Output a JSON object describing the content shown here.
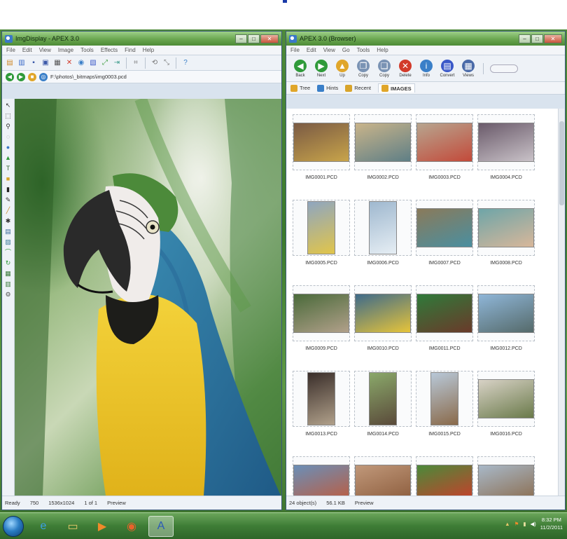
{
  "left_window": {
    "title": "ImgDisplay - APEX 3.0",
    "menu": [
      "File",
      "Edit",
      "View",
      "Image",
      "Tools",
      "Effects",
      "Find",
      "Help"
    ],
    "path": "F:\\photos\\_bitmaps\\img0003.pcd",
    "status": {
      "state": "Ready",
      "size": "750",
      "dims": "1536x1024",
      "ratio": "1 of 1",
      "label": "Preview"
    }
  },
  "right_window": {
    "title": "APEX 3.0 (Browser)",
    "menu": [
      "File",
      "Edit",
      "View",
      "Go",
      "Tools",
      "Help"
    ],
    "toolbar": [
      {
        "label": "Back",
        "icon": "back-icon",
        "color": "#2f9a3a"
      },
      {
        "label": "Next",
        "icon": "forward-icon",
        "color": "#2f9a3a"
      },
      {
        "label": "Up",
        "icon": "up-folder-icon",
        "color": "#e0a62a"
      },
      {
        "label": "Copy",
        "icon": "copy-icon",
        "color": "#7a93b4"
      },
      {
        "label": "Copy",
        "icon": "copy-to-icon",
        "color": "#7a93b4"
      },
      {
        "label": "Delete",
        "icon": "delete-icon",
        "color": "#d23a2a"
      },
      {
        "label": "Info",
        "icon": "info-icon",
        "color": "#3a7fc8"
      },
      {
        "label": "Convert",
        "icon": "convert-icon",
        "color": "#3a58c8"
      },
      {
        "label": "Views",
        "icon": "views-icon",
        "color": "#4a6aa8"
      }
    ],
    "tabs": [
      {
        "label": "Tree",
        "icon": "tree-icon"
      },
      {
        "label": "Hints",
        "icon": "hints-icon"
      },
      {
        "label": "Recent",
        "icon": "recent-icon"
      },
      {
        "label": "IMAGES",
        "icon": "folder-icon",
        "active": true
      }
    ],
    "thumbnails": [
      {
        "caption": "IMG0001.PCD",
        "orient": "landscape",
        "c1": "#7a5a44",
        "c2": "#c8a44a"
      },
      {
        "caption": "IMG0002.PCD",
        "orient": "landscape",
        "c1": "#c9b48a",
        "c2": "#5f7f86"
      },
      {
        "caption": "IMG0003.PCD",
        "orient": "landscape",
        "c1": "#b7a58f",
        "c2": "#c34a3a"
      },
      {
        "caption": "IMG0004.PCD",
        "orient": "landscape",
        "c1": "#6a5a6a",
        "c2": "#c9c2c8"
      },
      {
        "caption": "IMG0005.PCD",
        "orient": "portrait",
        "c1": "#8fa6c0",
        "c2": "#e1c54a"
      },
      {
        "caption": "IMG0006.PCD",
        "orient": "portrait",
        "c1": "#9fb8cf",
        "c2": "#e6eef4"
      },
      {
        "caption": "IMG0007.PCD",
        "orient": "landscape",
        "c1": "#8a7a5a",
        "c2": "#4a8fa0"
      },
      {
        "caption": "IMG0008.PCD",
        "orient": "landscape",
        "c1": "#6ea5a8",
        "c2": "#d8b79a"
      },
      {
        "caption": "IMG0009.PCD",
        "orient": "landscape",
        "c1": "#4a6a3a",
        "c2": "#b1a08a"
      },
      {
        "caption": "IMG0010.PCD",
        "orient": "landscape",
        "c1": "#3e6a8a",
        "c2": "#e6c43a"
      },
      {
        "caption": "IMG0011.PCD",
        "orient": "landscape",
        "c1": "#2f7a3a",
        "c2": "#6a3a2a"
      },
      {
        "caption": "IMG0012.PCD",
        "orient": "landscape",
        "c1": "#8fb6d8",
        "c2": "#556a6a"
      },
      {
        "caption": "IMG0013.PCD",
        "orient": "portrait",
        "c1": "#3a2e2a",
        "c2": "#b0a08a"
      },
      {
        "caption": "IMG0014.PCD",
        "orient": "portrait",
        "c1": "#8aa86a",
        "c2": "#5a4a3a"
      },
      {
        "caption": "IMG0015.PCD",
        "orient": "portrait",
        "c1": "#b8c8d8",
        "c2": "#8a6a4a"
      },
      {
        "caption": "IMG0016.PCD",
        "orient": "landscape",
        "c1": "#d8d2c6",
        "c2": "#6a7a4a"
      },
      {
        "caption": "",
        "orient": "landscape",
        "c1": "#6a8fb8",
        "c2": "#c05a3a"
      },
      {
        "caption": "",
        "orient": "landscape",
        "c1": "#c0987a",
        "c2": "#8a5a3a"
      },
      {
        "caption": "",
        "orient": "landscape",
        "c1": "#4a8a3a",
        "c2": "#d03a2a"
      },
      {
        "caption": "",
        "orient": "landscape",
        "c1": "#a8b8c8",
        "c2": "#8a6a4a"
      }
    ],
    "status": {
      "count": "24 object(s)",
      "size": "56.1 KB",
      "label": "Preview"
    }
  },
  "taskbar": {
    "apps": [
      {
        "name": "internet-explorer-icon",
        "glyph": "e",
        "color": "#3aa0e8"
      },
      {
        "name": "file-explorer-icon",
        "glyph": "▭",
        "color": "#e8c86a"
      },
      {
        "name": "media-player-icon",
        "glyph": "▶",
        "color": "#f08a2a"
      },
      {
        "name": "firefox-icon",
        "glyph": "◉",
        "color": "#e8622a"
      },
      {
        "name": "apex-app-icon",
        "glyph": "A",
        "color": "#2a5ab8",
        "active": true
      }
    ],
    "clock_time": "8:32 PM",
    "clock_date": "11/2/2011"
  }
}
